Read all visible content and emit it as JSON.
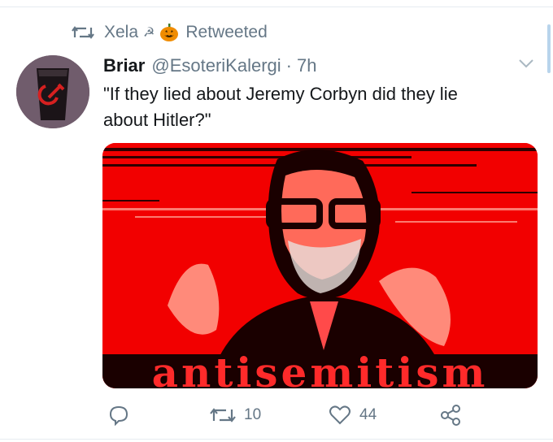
{
  "retweet_context": {
    "icon": "retweet-icon",
    "name": "Xela",
    "emoji_sickle": "☭",
    "emoji_pumpkin": "pumpkin-icon",
    "label": "Retweeted"
  },
  "tweet": {
    "display_name": "Briar",
    "handle": "@EsoteriKalergi",
    "separator": "·",
    "time": "7h",
    "text": "\"If they lied about Jeremy Corbyn did they lie\nabout Hitler?\"",
    "media_caption": "antisemitism"
  },
  "actions": {
    "reply": {
      "icon": "reply-icon",
      "count": ""
    },
    "retweet": {
      "icon": "retweet-icon",
      "count": "10"
    },
    "like": {
      "icon": "heart-icon",
      "count": "44"
    },
    "share": {
      "icon": "share-icon",
      "count": ""
    }
  },
  "colors": {
    "text": "#14171a",
    "muted": "#657786",
    "media_red": "#f20000"
  }
}
